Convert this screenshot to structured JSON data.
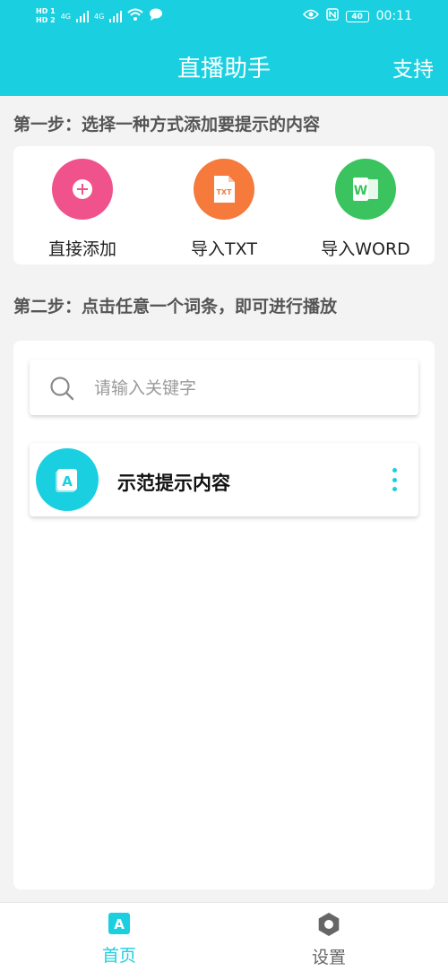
{
  "colors": {
    "primary": "#1ad0e0",
    "add_button": "#f0538b",
    "txt_button": "#f57a3c",
    "word_button": "#3ac35f",
    "nav_inactive": "#666666"
  },
  "status_bar": {
    "time": "00:11",
    "battery": "40",
    "network_1": "4G",
    "network_2": "4G",
    "icons": [
      "hd-icon",
      "signal-icon",
      "wifi-icon",
      "chat-icon",
      "eye-icon",
      "nfc-icon",
      "battery-icon"
    ]
  },
  "header": {
    "title": "直播助手",
    "action": "支持"
  },
  "step1": {
    "label": "第一步：选择一种方式添加要提示的内容",
    "actions": [
      {
        "label": "直接添加",
        "icon": "plus-icon"
      },
      {
        "label": "导入TXT",
        "icon": "txt-file-icon",
        "icon_text": "TXT"
      },
      {
        "label": "导入WORD",
        "icon": "word-icon",
        "icon_text": "W"
      }
    ]
  },
  "step2": {
    "label": "第二步：点击任意一个词条，即可进行播放",
    "search": {
      "placeholder": "请输入关键字",
      "value": ""
    },
    "items": [
      {
        "title": "示范提示内容",
        "avatar_letter": "A"
      }
    ]
  },
  "bottom_nav": {
    "items": [
      {
        "label": "首页",
        "icon": "home-a-icon",
        "icon_text": "A",
        "active": true
      },
      {
        "label": "设置",
        "icon": "settings-hex-icon",
        "active": false
      }
    ]
  }
}
